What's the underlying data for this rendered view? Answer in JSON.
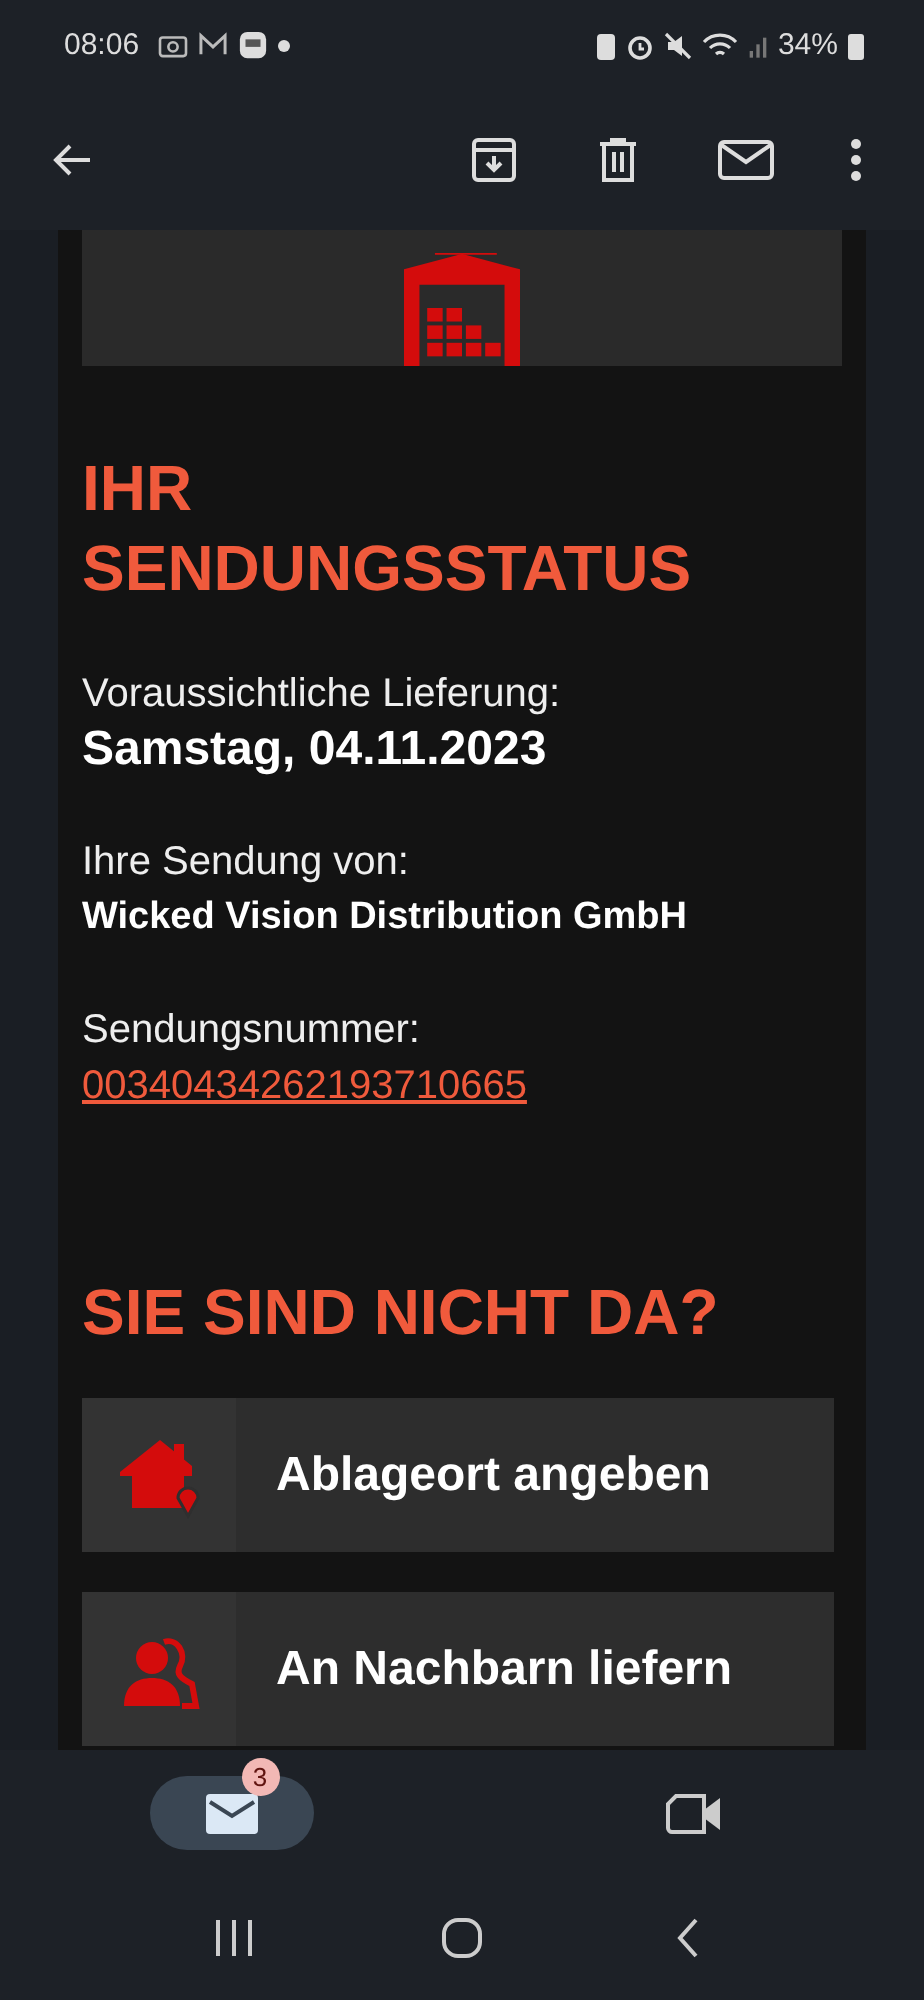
{
  "status_bar": {
    "time": "08:06",
    "battery": "34%"
  },
  "email": {
    "heading": "IHR SENDUNGSSTATUS",
    "fields": [
      {
        "label": "Voraussichtliche Lieferung:",
        "value": "Samstag, 04.11.2023",
        "kind": "large"
      },
      {
        "label": "Ihre Sendung von:",
        "value": "Wicked Vision Distribution GmbH",
        "kind": "bold"
      },
      {
        "label": "Sendungsnummer:",
        "value": "00340434262193710665",
        "kind": "link"
      }
    ],
    "section_heading": "SIE SIND NICHT DA?",
    "actions": [
      {
        "label": "Ablageort angeben",
        "kind": "place"
      },
      {
        "label": "An Nachbarn liefern",
        "kind": "neighbor"
      }
    ]
  },
  "bottom_nav": [
    {
      "kind": "mail",
      "selected": true,
      "badge": "3"
    },
    {
      "kind": "video",
      "selected": false
    }
  ]
}
